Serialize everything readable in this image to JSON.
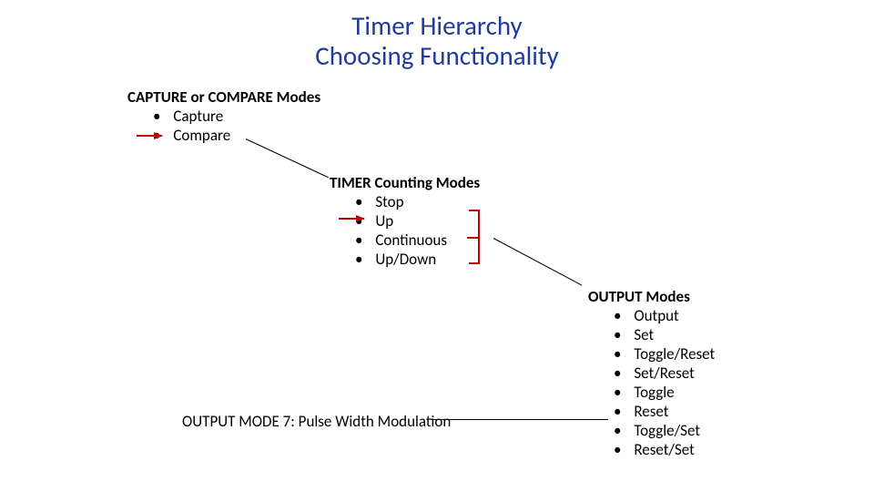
{
  "title_line1": "Timer Hierarchy",
  "title_line2": "Choosing Functionality",
  "capture": {
    "heading": "CAPTURE or COMPARE Modes",
    "items": [
      "Capture",
      "Compare"
    ]
  },
  "timer": {
    "heading": "TIMER Counting Modes",
    "items": [
      "Stop",
      "Up",
      "Continuous",
      "Up/Down"
    ]
  },
  "output": {
    "heading": "OUTPUT Modes",
    "items": [
      "Output",
      "Set",
      "Toggle/Reset",
      "Set/Reset",
      "Toggle",
      "Reset",
      "Toggle/Set",
      "Reset/Set"
    ]
  },
  "note": "OUTPUT MODE 7: Pulse Width Modulation"
}
